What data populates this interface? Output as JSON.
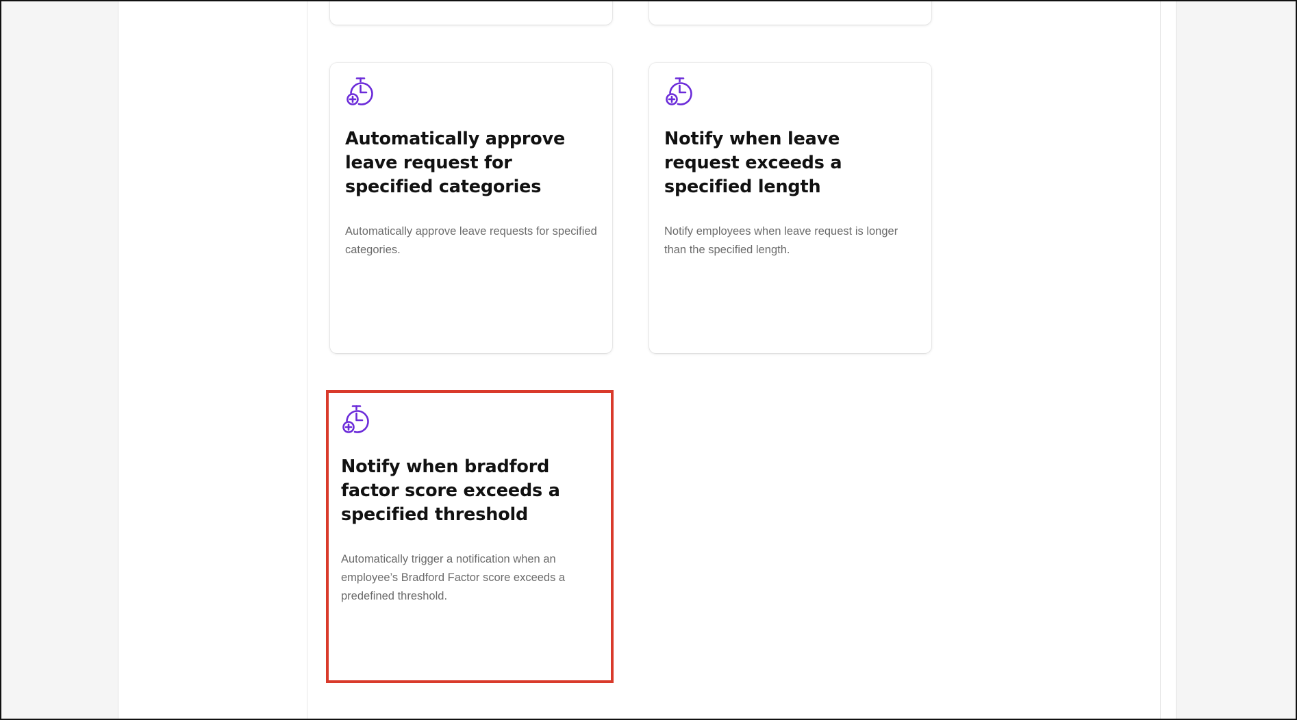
{
  "colors": {
    "accent_icon": "#6b2bd9",
    "highlight_border": "#d93a2b",
    "title_text": "#111111",
    "desc_text": "#6b6b6b",
    "side_panel": "#f5f5f5"
  },
  "cards": [
    {
      "icon": "stopwatch-plus-icon",
      "title": "Automatically approve leave request for specified categories",
      "description": "Automatically approve leave requests for specified categories."
    },
    {
      "icon": "stopwatch-plus-icon",
      "title": "Notify when leave request exceeds a specified length",
      "description": "Notify employees when leave request is longer than the specified length."
    },
    {
      "icon": "stopwatch-plus-icon",
      "title": "Notify when bradford factor score exceeds a specified threshold",
      "description": "Automatically trigger a notification when an employee’s Bradford Factor score exceeds a predefined threshold.",
      "highlighted": true
    }
  ]
}
